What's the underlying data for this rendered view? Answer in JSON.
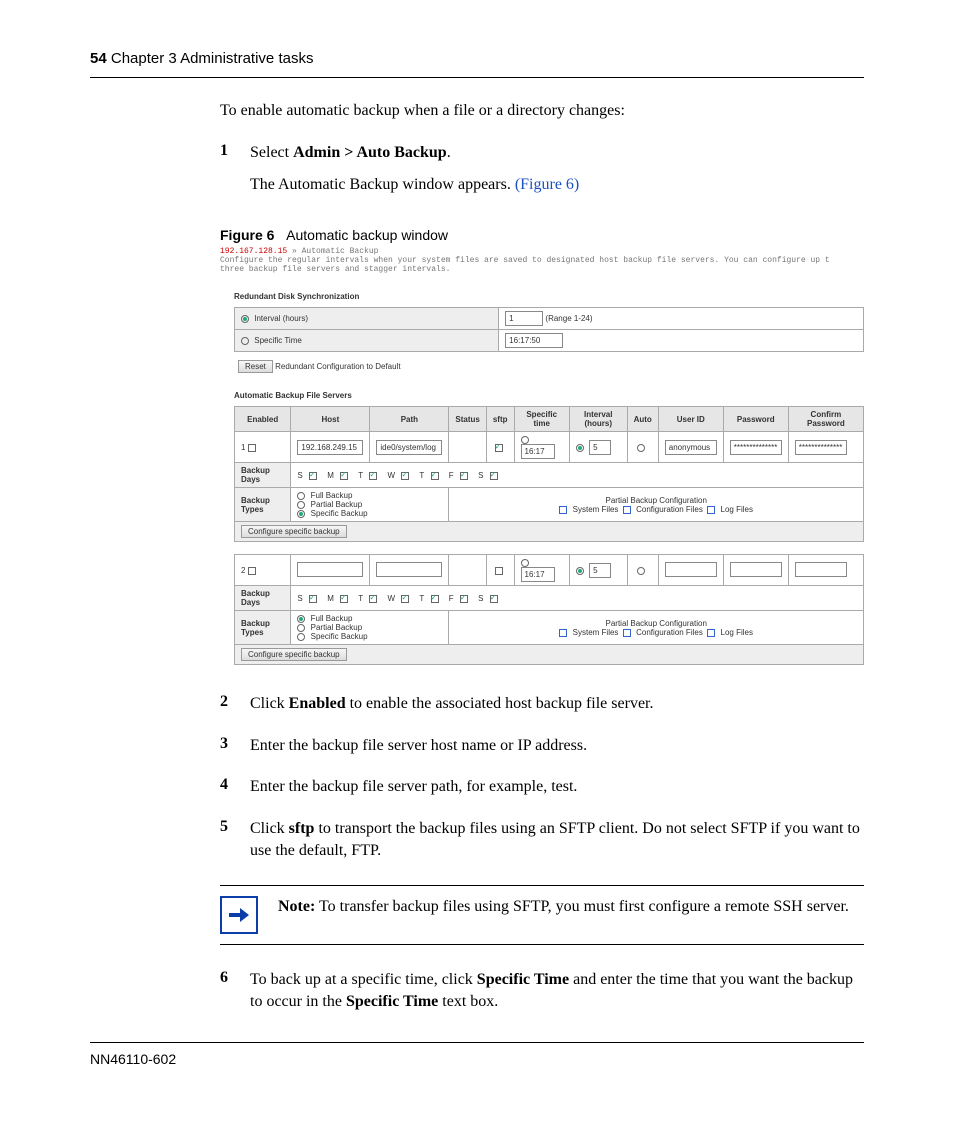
{
  "header": {
    "page_num": "54",
    "chapter": "Chapter 3  Administrative tasks"
  },
  "intro": "To enable automatic backup when a file or a directory changes:",
  "step1": {
    "num": "1",
    "line1a": "Select ",
    "line1b": "Admin > Auto Backup",
    "line1c": ".",
    "line2a": "The Automatic Backup window appears. ",
    "line2b": "(Figure 6)"
  },
  "figure": {
    "label": "Figure 6",
    "title": "Automatic backup window"
  },
  "ss": {
    "ip": "192.167.128.15",
    "crumb": " » Automatic Backup",
    "desc1": "Configure the regular intervals when your system files are saved to designated host backup file servers.  You can configure up t",
    "desc2": "three backup file servers and stagger intervals.",
    "redund_title": "Redundant Disk Synchronization",
    "interval_label": "Interval (hours)",
    "interval_val": "1",
    "range": "(Range 1-24)",
    "specific_label": "Specific Time",
    "specific_val": "16:17:50",
    "reset": "Reset",
    "reset_txt": " Redundant Configuration to Default",
    "servers_title": "Automatic Backup File Servers",
    "cols": {
      "enabled": "Enabled",
      "host": "Host",
      "path": "Path",
      "status": "Status",
      "sftp": "sftp",
      "stime": "Specific time",
      "intv": "Interval (hours)",
      "auto": "Auto",
      "userid": "User ID",
      "pwd": "Password",
      "cpwd": "Confirm Password"
    },
    "row1": {
      "idx": "1",
      "host": "192.168.249.15",
      "path": "ide0/system/log",
      "time": "16:17",
      "intv": "5",
      "user": "anonymous",
      "pwd": "**************",
      "cpwd": "**************"
    },
    "days_label": "Backup Days",
    "days": {
      "s": "S",
      "m": "M",
      "t": "T",
      "w": "W",
      "f": "F"
    },
    "types_label": "Backup Types",
    "types": {
      "full": "Full Backup",
      "partial": "Partial Backup",
      "specific": "Specific Backup"
    },
    "partial_title": "Partial Backup Configuration",
    "partial_opts": {
      "sys": "System Files",
      "cfg": "Configuration Files",
      "log": "Log Files"
    },
    "cfg_btn": "Configure specific backup",
    "row2": {
      "idx": "2",
      "time": "16:17",
      "intv": "5"
    }
  },
  "step2": {
    "num": "2",
    "a": "Click ",
    "b": "Enabled",
    "c": " to enable the associated host backup file server."
  },
  "step3": {
    "num": "3",
    "a": "Enter the backup file server host name or IP address."
  },
  "step4": {
    "num": "4",
    "a": "Enter the backup file server path, for example, test."
  },
  "step5": {
    "num": "5",
    "a": "Click ",
    "b": "sftp",
    "c": " to transport the backup files using an SFTP client. Do not select SFTP if you want to use the default, FTP."
  },
  "note": {
    "b": "Note:",
    "t": " To transfer backup files using SFTP, you must first configure a remote SSH server."
  },
  "step6": {
    "num": "6",
    "a": "To back up at a specific time, click ",
    "b": "Specific Time",
    "c": " and enter the time that you want the backup to occur in the ",
    "d": "Specific Time",
    "e": " text box."
  },
  "footer": "NN46110-602"
}
